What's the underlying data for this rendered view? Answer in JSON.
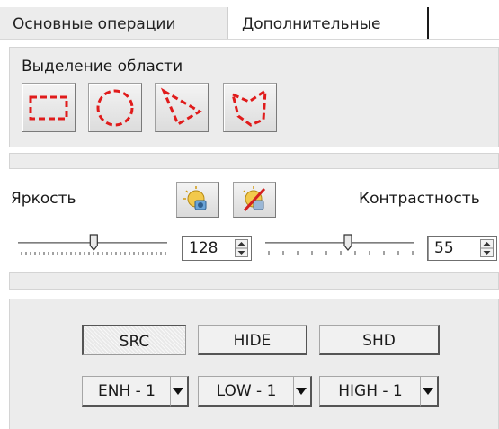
{
  "tabs": [
    {
      "label": "Основные операции",
      "active": false
    },
    {
      "label": "Дополнительные",
      "active": true
    }
  ],
  "selection": {
    "label": "Выделение области",
    "tools": [
      {
        "name": "rectangle",
        "icon": "dashed-rectangle-icon"
      },
      {
        "name": "ellipse",
        "icon": "dashed-circle-icon"
      },
      {
        "name": "triangle",
        "icon": "dashed-triangle-icon"
      },
      {
        "name": "polygon",
        "icon": "dashed-polygon-icon"
      }
    ]
  },
  "adjust": {
    "brightness_label": "Яркость",
    "contrast_label": "Контрастность",
    "icons": [
      "auto-adjust-icon",
      "reset-adjust-icon"
    ],
    "brightness": {
      "value": "128",
      "min": 0,
      "max": 255
    },
    "contrast": {
      "value": "55",
      "min": 0,
      "max": 100
    }
  },
  "modes": {
    "buttons": [
      {
        "label": "SRC",
        "pressed": true
      },
      {
        "label": "HIDE",
        "pressed": false
      },
      {
        "label": "SHD",
        "pressed": false
      }
    ],
    "dropdowns": [
      {
        "label": "ENH - 1"
      },
      {
        "label": "LOW - 1"
      },
      {
        "label": "HIGH - 1"
      }
    ]
  },
  "colors": {
    "panel_bg": "#ececec",
    "dash_red": "#e01b1b",
    "border_dark": "#555555"
  }
}
